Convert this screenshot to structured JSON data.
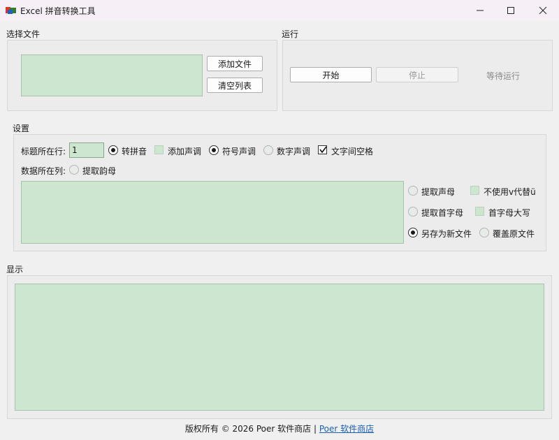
{
  "window": {
    "title": "Excel 拼音转换工具",
    "icon": "excel-pinyin-app-icon",
    "controls": [
      "minimize-icon",
      "maximize-icon",
      "close-icon"
    ]
  },
  "file_group": {
    "label": "选择文件",
    "add_button": "添加文件",
    "clear_button": "清空列表"
  },
  "run_group": {
    "label": "运行",
    "start_button": "开始",
    "stop_button": "停止",
    "status": "等待运行"
  },
  "settings": {
    "label": "设置",
    "title_row_label": "标题所在行:",
    "title_row_value": "1",
    "data_col_label": "数据所在列:",
    "options": {
      "convert_pinyin": "转拼音",
      "add_tone": "添加声调",
      "symbol_tone": "符号声调",
      "number_tone": "数字声调",
      "space_between": "文字间空格",
      "extract_final": "提取韵母",
      "extract_initial": "提取声母",
      "no_v_for_u": "不使用v代替ü",
      "extract_first_letter": "提取首字母",
      "first_letter_upper": "首字母大写",
      "save_as_new": "另存为新文件",
      "overwrite": "覆盖原文件"
    },
    "state": {
      "convert_pinyin": true,
      "add_tone": false,
      "symbol_tone": true,
      "number_tone": false,
      "space_between": true,
      "extract_final": false,
      "extract_initial": false,
      "no_v_for_u": false,
      "extract_first_letter": false,
      "first_letter_upper": false,
      "save_as_new": true,
      "overwrite": false
    }
  },
  "display_group": {
    "label": "显示"
  },
  "footer": {
    "copyright": "版权所有 © 2026 Poer 软件商店 |",
    "link": "Poer 软件商店"
  },
  "colors": {
    "window_bg": "#f0f0f0",
    "titlebar_bg": "#f6f0f6",
    "list_bg": "#cde6cf",
    "link": "#1a5fb4"
  }
}
